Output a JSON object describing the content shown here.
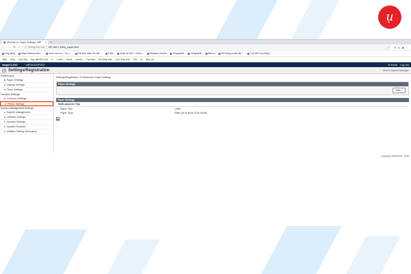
{
  "brand_logo": "ụ",
  "browser": {
    "tab_title": "Remote UI: Paper Settings: LBP",
    "address": {
      "secure_label": "Không bảo mật",
      "url": "192.168.1.248/p_paper.html"
    },
    "bookmarks_row1": [
      "Ứng dụng",
      "https://webcounter…",
      "ninco.com.vn - Tìm i…",
      "Hệ điều hành lỗi mất…",
      "Trello",
      "Quản trị SEO - Dulux…",
      "Bergamo Admin",
      "Infographic",
      "Infographic",
      "Batcro",
      "Hệ thống social site…",
      "Tìm hiểu hợp đồng…"
    ],
    "bookmarks_row2": [
      "Help",
      "Help",
      "Font site",
      "Agx.diff.SEO.SN",
      "Il",
      "+ Hele",
      "whole",
      "source",
      "Font site",
      "Kết Giúp Ads",
      "Tool Giúp Ads",
      "PRI",
      "Ik",
      "Mục lục"
    ]
  },
  "app": {
    "brand": "imageCLASS",
    "model": "LBP151/LBP151/",
    "header_links": [
      "To Portal",
      "Log Out"
    ],
    "page_title": "Settings/Registration",
    "mail_link": "Mail to System Manager"
  },
  "sidebar": {
    "preferences_header": "Preferences",
    "preferences_items": [
      "Paper Settings",
      "Display Settings",
      "Timer Settings"
    ],
    "function_header": "Function Settings",
    "function_items": [
      "Common Settings",
      "Printer Settings"
    ],
    "system_header": "System Management Settings",
    "system_items": [
      "System Management",
      "Network Settings",
      "Security Settings",
      "Update Firmware",
      "Initialize Setting Information"
    ]
  },
  "main": {
    "breadcrumb": "Settings/Registration: Preferences: Paper Settings",
    "panel_title": "Paper Settings",
    "edit_button": "Edit...",
    "section_title": "Paper Settings",
    "sub_title": "Multi-purpose Tray",
    "rows": [
      {
        "key": "Paper Size:",
        "value": "Letter"
      },
      {
        "key": "Paper Type:",
        "value": "Plain (16 lb Bond-23 lb Bond)"
      }
    ],
    "footer": "Copyright CANON INC. 2015"
  },
  "colors": {
    "header_bg": "#0e2a4e",
    "panel_header": "#5b6878",
    "highlight_border": "#e01e1e",
    "logo": "#e3232a"
  }
}
